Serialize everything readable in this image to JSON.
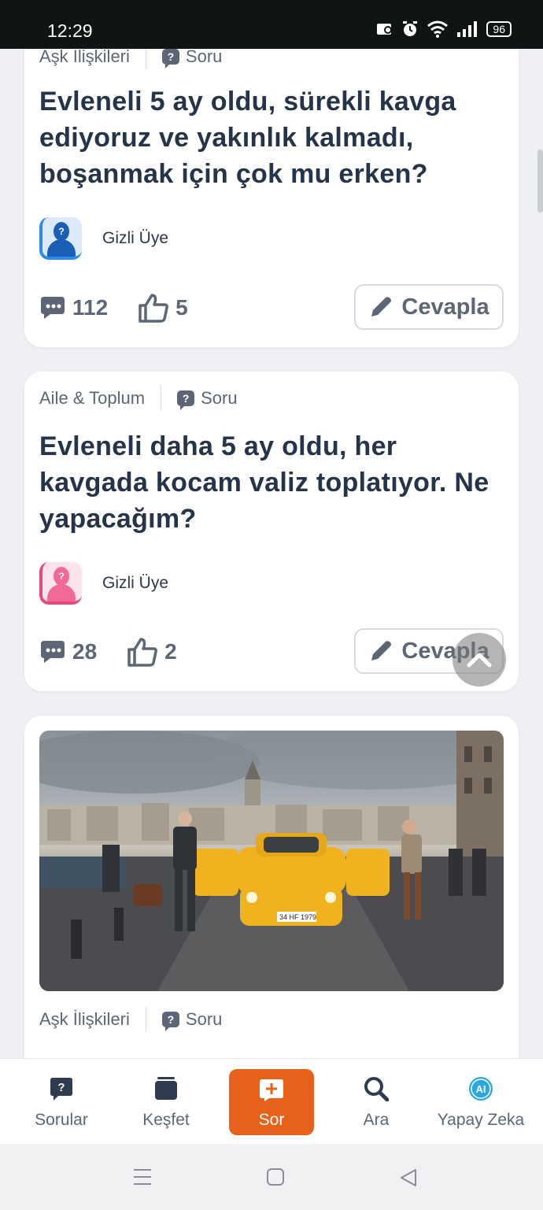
{
  "status_bar": {
    "time": "12:29",
    "battery": "96"
  },
  "cards": [
    {
      "category": "Aşk İlişkileri",
      "type": "Soru",
      "title": "Evleneli 5 ay oldu, sürekli kavga ediyoruz ve yakınlık kalmadı, boşanmak için çok mu erken?",
      "author": "Gizli Üye",
      "comments": "112",
      "likes": "5",
      "answer_label": "Cevapla"
    },
    {
      "category": "Aile & Toplum",
      "type": "Soru",
      "title": "Evleneli daha 5 ay oldu, her kavgada kocam valiz toplatıyor. Ne yapacağım?",
      "author": "Gizli Üye",
      "comments": "28",
      "likes": "2",
      "answer_label": "Cevapla"
    },
    {
      "category": "Aşk İlişkileri",
      "type": "Soru",
      "plate": "34 HF 1979"
    }
  ],
  "bottom_nav": {
    "questions": "Sorular",
    "explore": "Keşfet",
    "ask": "Sor",
    "search": "Ara",
    "ai": "Yapay Zeka",
    "ai_badge": "AI"
  },
  "colors": {
    "accent": "#e8611a",
    "ai": "#2aa7e0"
  }
}
